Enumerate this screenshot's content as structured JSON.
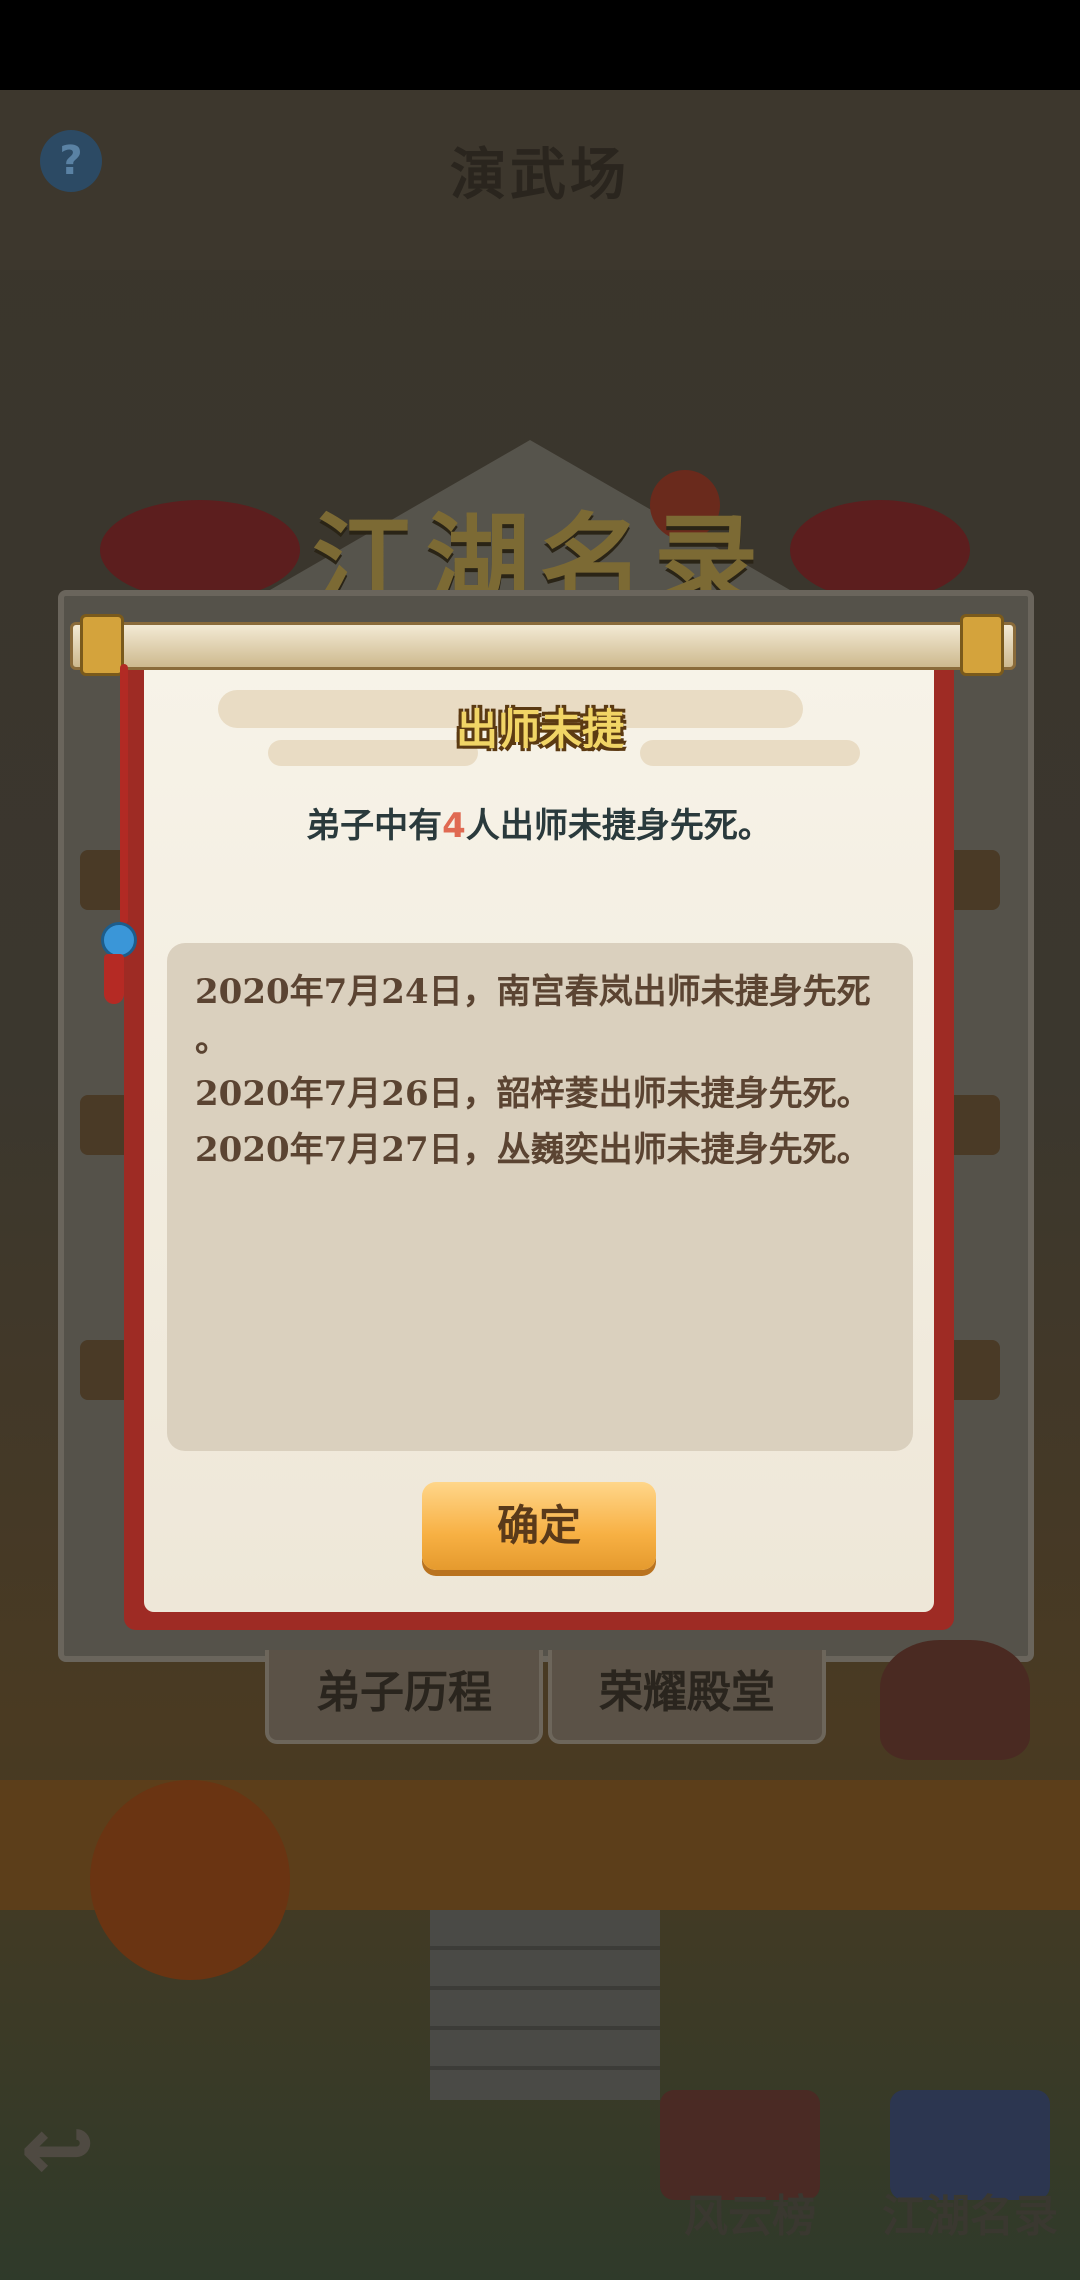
{
  "background": {
    "page_title": "演武场",
    "help_icon_glyph": "?",
    "banner_title": "江湖名录",
    "tabs": [
      {
        "label": "弟子历程"
      },
      {
        "label": "荣耀殿堂"
      }
    ],
    "bottom_nav": [
      {
        "label": "风云榜"
      },
      {
        "label": "江湖名录"
      }
    ]
  },
  "dialog": {
    "heading": "出师未捷",
    "summary_prefix": "弟子中有",
    "summary_count": "4",
    "summary_suffix": "人出师未捷身先死。",
    "log_lines": [
      "2020年7月24日，南宫春岚出师未捷身先死",
      "。",
      "2020年7月26日，韶梓菱出师未捷身先死。",
      "2020年7月27日，丛巍奕出师未捷身先死。"
    ],
    "confirm_label": "确定"
  },
  "colors": {
    "accent_orange": "#f7b043",
    "scroll_red": "#9e2b24",
    "count_highlight": "#e06a52",
    "heading_gold": "#f1d566"
  }
}
